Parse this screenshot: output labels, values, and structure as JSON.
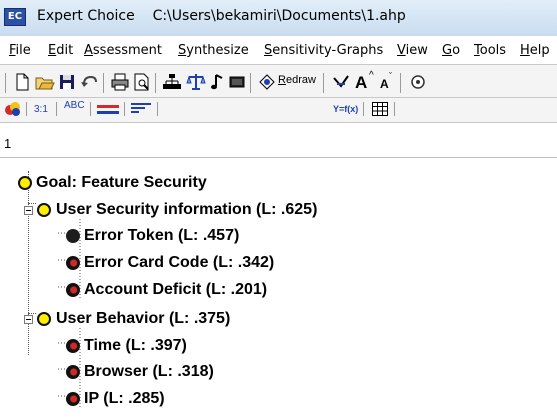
{
  "window": {
    "app_name": "Expert Choice",
    "file_path": "C:\\Users\\bekamiri\\Documents\\1.ahp",
    "app_icon_text": "EC",
    "app_icon_color": "#2b50a8"
  },
  "menu": {
    "items": [
      "File",
      "Edit",
      "Assessment",
      "Synthesize",
      "Sensitivity-Graphs",
      "View",
      "Go",
      "Tools",
      "Help"
    ]
  },
  "toolbar": {
    "icons": [
      "new-document-icon",
      "open-folder-icon",
      "save-icon",
      "undo-icon",
      "print-icon",
      "print-preview-icon",
      "hierarchy-icon",
      "scales-icon",
      "music-note-icon",
      "monitor-icon",
      "redraw-icon",
      "pointer-icon",
      "font-increase-icon",
      "font-decrease-icon",
      "settings-icon"
    ],
    "redraw_label": "Redraw",
    "font_increase_glyph": "A",
    "font_decrease_glyph": "A"
  },
  "formatbar": {
    "ratio_label": "3:1",
    "abc_label": "ABC",
    "formula_label": "Y=f(x)"
  },
  "entry": {
    "value": "1"
  },
  "tree": {
    "goal": "Goal: Feature Security",
    "groups": [
      {
        "label": "User Security information (L: .625)",
        "children": [
          "Error Token (L: .457)",
          "Error Card Code (L: .342)",
          "Account Deficit (L: .201)"
        ]
      },
      {
        "label": "User Behavior (L: .375)",
        "children": [
          "Time (L: .397)",
          "Browser (L: .318)",
          "IP (L: .285)"
        ]
      }
    ]
  },
  "colors": {
    "goal_node": "#ffee00",
    "leaf_node": "#1d1d1d",
    "leaf_center": "#cf2a2a",
    "accent": "#1f3fb0"
  }
}
